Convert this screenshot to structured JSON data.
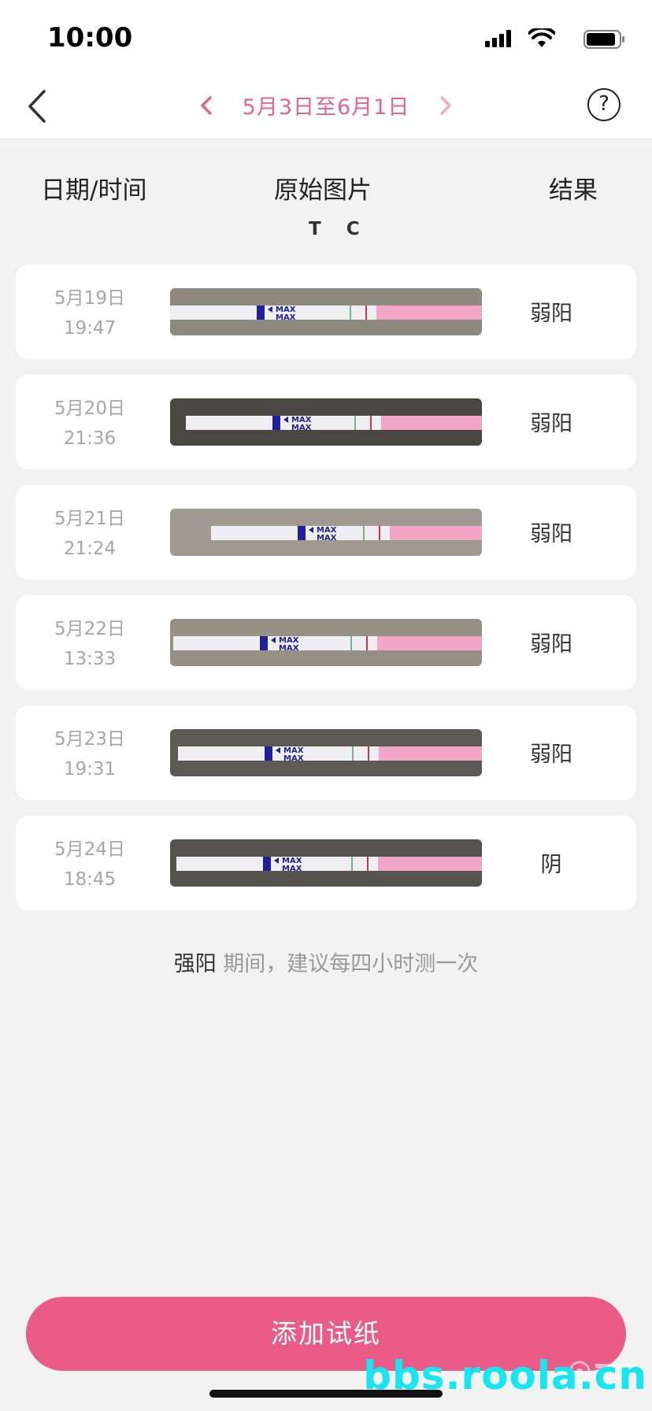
{
  "status_bar": {
    "time": "10:00"
  },
  "nav": {
    "date_range": "5月3日至6月1日",
    "help_label": "?"
  },
  "headers": {
    "date": "日期/时间",
    "image": "原始图片",
    "result": "结果",
    "tc": "T C"
  },
  "strip_text": {
    "max": "MAX"
  },
  "records": [
    {
      "date": "5月19日",
      "time": "19:47",
      "result": "弱阳",
      "bg": "#8f8a80"
    },
    {
      "date": "5月20日",
      "time": "21:36",
      "result": "弱阳",
      "bg": "#4a4743"
    },
    {
      "date": "5月21日",
      "time": "21:24",
      "result": "弱阳",
      "bg": "#a09a92"
    },
    {
      "date": "5月22日",
      "time": "13:33",
      "result": "弱阳",
      "bg": "#958f86"
    },
    {
      "date": "5月23日",
      "time": "19:31",
      "result": "弱阳",
      "bg": "#5d5a55"
    },
    {
      "date": "5月24日",
      "time": "18:45",
      "result": "阴",
      "bg": "#56534f"
    }
  ],
  "tip": {
    "strong": "强阳",
    "text": " 期间，建议每四小时测一次"
  },
  "add_button": {
    "label": "添加试纸"
  },
  "watermark": {
    "text": "bbs.roola.cn"
  },
  "colors": {
    "accent": "#eb5b88",
    "nav_accent": "#e8628e",
    "background": "#f2f2f2"
  }
}
